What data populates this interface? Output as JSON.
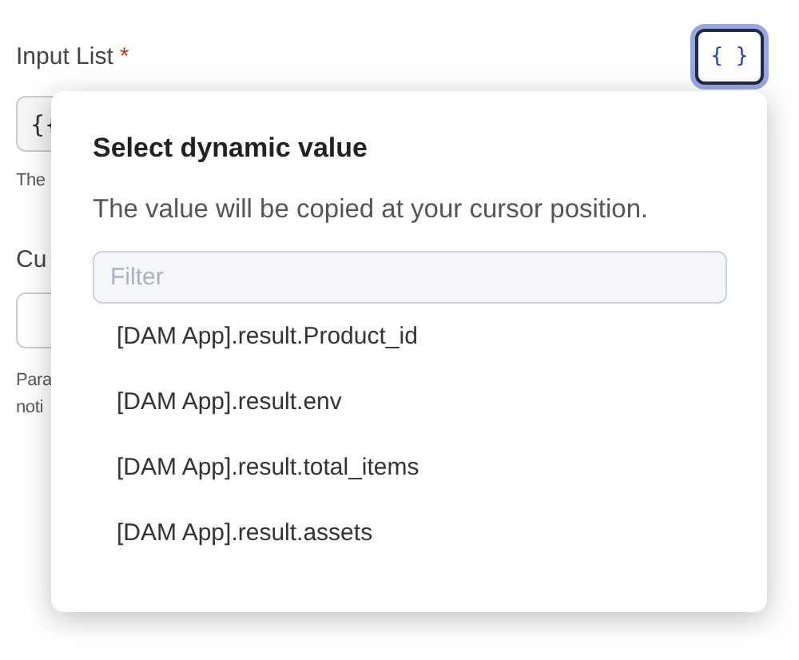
{
  "input_list": {
    "label": "Input List",
    "required_mark": "*",
    "dynamic_button": "{ }",
    "value": "{{",
    "help": "The"
  },
  "second_field": {
    "label": "Cu",
    "help_lines": [
      "Para",
      "noti"
    ]
  },
  "popover": {
    "title": "Select dynamic value",
    "subtitle": "The value will be copied at your cursor position.",
    "filter_placeholder": "Filter",
    "items": [
      "[DAM App].result.Product_id",
      "[DAM App].result.env",
      "[DAM App].result.total_items",
      "[DAM App].result.assets"
    ]
  }
}
